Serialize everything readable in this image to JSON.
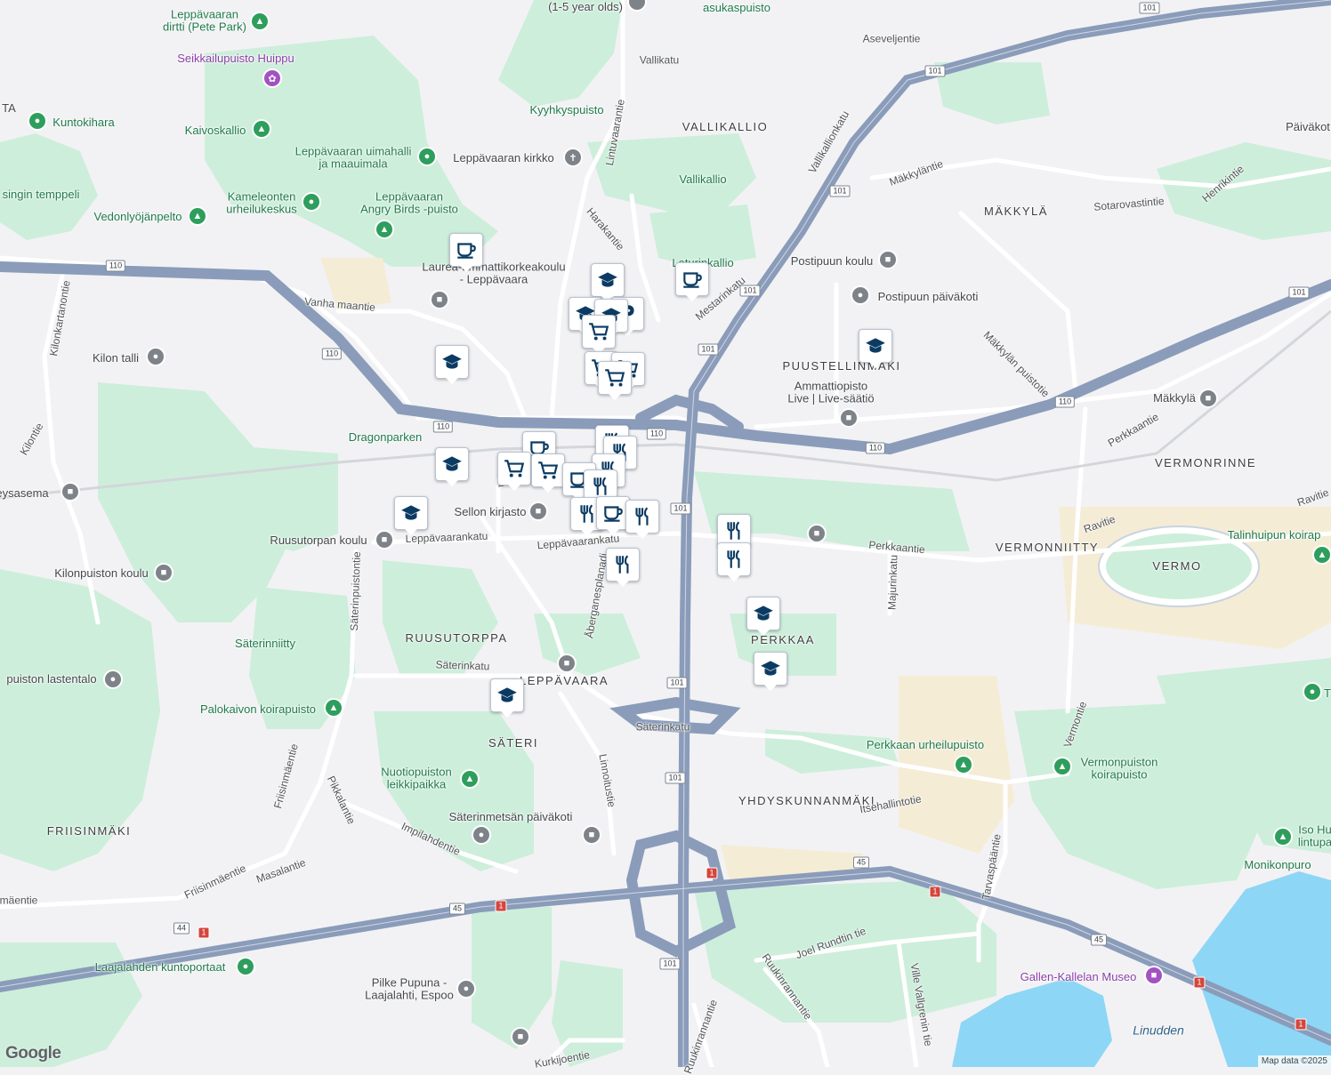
{
  "map": {
    "districts": [
      {
        "name": "VALLIKALLIO"
      },
      {
        "name": "MÄKKYLÄ"
      },
      {
        "name": "PUUSTELLINMÄKI"
      },
      {
        "name": "VERMONRINNE"
      },
      {
        "name": "VERMONNIITTY"
      },
      {
        "name": "VERMO"
      },
      {
        "name": "RUUSUTORPPA"
      },
      {
        "name": "LEPPÄVAARA"
      },
      {
        "name": "SÄTERI"
      },
      {
        "name": "PERKKAA"
      },
      {
        "name": "YHDYSKUNNANMÄKI"
      },
      {
        "name": "FRIISINMÄKI"
      }
    ],
    "places": [
      {
        "name": "(1-5 year olds)",
        "kind": "gray"
      },
      {
        "name": "asukaspuisto",
        "kind": "green"
      },
      {
        "name": "Leppävaaran\ndirtti (Pete Park)",
        "kind": "green"
      },
      {
        "name": "Seikkailupuisto Huippu",
        "kind": "purple"
      },
      {
        "name": "Kuntokihara",
        "kind": "green"
      },
      {
        "name": "Kaivoskallio",
        "kind": "green"
      },
      {
        "name": "Leppävaaran uimahalli\nja maauimala",
        "kind": "green"
      },
      {
        "name": "Kameleonten\nurheilukeskus",
        "kind": "green"
      },
      {
        "name": "Leppävaaran\nAngry Birds -puisto",
        "kind": "green"
      },
      {
        "name": "Vedonlyöjänpelto",
        "kind": "green"
      },
      {
        "name": "singin temppeli",
        "kind": "green"
      },
      {
        "name": "Kyyhkyspuisto",
        "kind": "green"
      },
      {
        "name": "Leppävaaran kirkko",
        "kind": "gray"
      },
      {
        "name": "Vallikallio",
        "kind": "green"
      },
      {
        "name": "Laturinkallio",
        "kind": "green"
      },
      {
        "name": "Laurea-ammattikorkeakoulu\n- Leppävaara",
        "kind": "gray"
      },
      {
        "name": "Postipuun koulu",
        "kind": "gray"
      },
      {
        "name": "Postipuun päiväkoti",
        "kind": "gray"
      },
      {
        "name": "Ammattiopisto\nLive | Live-säätiö",
        "kind": "gray"
      },
      {
        "name": "Mäkkylä",
        "kind": "gray"
      },
      {
        "name": "Kilon talli",
        "kind": "gray"
      },
      {
        "name": "Dragonparken",
        "kind": "green"
      },
      {
        "name": "eysasema",
        "kind": "gray"
      },
      {
        "name": "Sellon kirjasto",
        "kind": "gray"
      },
      {
        "name": "Ruusutorpan koulu",
        "kind": "gray"
      },
      {
        "name": "Kilonpuiston koulu",
        "kind": "gray"
      },
      {
        "name": "Säterinniitty",
        "kind": "green"
      },
      {
        "name": "puiston lastentalo",
        "kind": "gray"
      },
      {
        "name": "Palokaivon koirapuisto",
        "kind": "green"
      },
      {
        "name": "Nuotiopuiston\nleikkipaikka",
        "kind": "green"
      },
      {
        "name": "Säterinmetsän päiväkoti",
        "kind": "gray"
      },
      {
        "name": "Perkkaan urheilupuisto",
        "kind": "green"
      },
      {
        "name": "Vermonpuiston\nkoirapuisto",
        "kind": "green"
      },
      {
        "name": "Talinhuipun koirap",
        "kind": "green"
      },
      {
        "name": "Monikonpuro",
        "kind": "green"
      },
      {
        "name": "Iso Hu\nlintupa",
        "kind": "green"
      },
      {
        "name": "Laajalahden kuntoportaat",
        "kind": "green"
      },
      {
        "name": "Pilke Pupuna -\nLaajalahti, Espoo",
        "kind": "gray"
      },
      {
        "name": "Gallen-Kallelan Museo",
        "kind": "purple"
      },
      {
        "name": "Linudden",
        "kind": "water"
      },
      {
        "name": "Päiväkot",
        "kind": "gray"
      },
      {
        "name": "TA",
        "kind": "gray"
      },
      {
        "name": "T",
        "kind": "green"
      }
    ],
    "roads": [
      {
        "name": "Vallikatu"
      },
      {
        "name": "Aseveljentie"
      },
      {
        "name": "Lintuvaarantie"
      },
      {
        "name": "Harakantie"
      },
      {
        "name": "Mestarinkatu"
      },
      {
        "name": "Vallikallionkatu"
      },
      {
        "name": "Mäkkyläntie"
      },
      {
        "name": "Sotarovastintie"
      },
      {
        "name": "Henrikintie"
      },
      {
        "name": "Mäkkylän puistotie"
      },
      {
        "name": "Perkkaantie"
      },
      {
        "name": "Vanha maantie"
      },
      {
        "name": "Kilonkartanontie"
      },
      {
        "name": "Kilontie"
      },
      {
        "name": "Leppävaarankatu"
      },
      {
        "name": "Leppävaarankatu"
      },
      {
        "name": "Perkkaantie"
      },
      {
        "name": "Majurinkatu"
      },
      {
        "name": "Ravitie"
      },
      {
        "name": "Ravitie"
      },
      {
        "name": "Säterinpuistontie"
      },
      {
        "name": "Åberganesplanadi"
      },
      {
        "name": "Säterinkatu"
      },
      {
        "name": "Säterinkatu"
      },
      {
        "name": "Linnoitustie"
      },
      {
        "name": "Friisinmäentie"
      },
      {
        "name": "Pikkalantie"
      },
      {
        "name": "Impilahdentie"
      },
      {
        "name": "Masalantie"
      },
      {
        "name": "Friisinmäentie"
      },
      {
        "name": "mäentie"
      },
      {
        "name": "Itsehallintotie"
      },
      {
        "name": "Vermontie"
      },
      {
        "name": "Tarvaspääntie"
      },
      {
        "name": "Joel Rundtin tie"
      },
      {
        "name": "Ruukinrannantie"
      },
      {
        "name": "Ruukinrannantie"
      },
      {
        "name": "Ville Vallgrenin tie"
      },
      {
        "name": "Kurkijoentie"
      },
      {
        "name": "Ra"
      }
    ],
    "shields": [
      {
        "num": "101",
        "kind": "white"
      },
      {
        "num": "101",
        "kind": "white"
      },
      {
        "num": "101",
        "kind": "white"
      },
      {
        "num": "101",
        "kind": "white"
      },
      {
        "num": "101",
        "kind": "white"
      },
      {
        "num": "101",
        "kind": "white"
      },
      {
        "num": "101",
        "kind": "white"
      },
      {
        "num": "101",
        "kind": "white"
      },
      {
        "num": "101",
        "kind": "white"
      },
      {
        "num": "101",
        "kind": "white"
      },
      {
        "num": "110",
        "kind": "white"
      },
      {
        "num": "110",
        "kind": "white"
      },
      {
        "num": "110",
        "kind": "white"
      },
      {
        "num": "110",
        "kind": "white"
      },
      {
        "num": "110",
        "kind": "white"
      },
      {
        "num": "110",
        "kind": "white"
      },
      {
        "num": "110",
        "kind": "white"
      },
      {
        "num": "45",
        "kind": "white"
      },
      {
        "num": "45",
        "kind": "white"
      },
      {
        "num": "45",
        "kind": "white"
      },
      {
        "num": "44",
        "kind": "white"
      },
      {
        "num": "1",
        "kind": "red"
      },
      {
        "num": "1",
        "kind": "red"
      },
      {
        "num": "1",
        "kind": "red"
      },
      {
        "num": "1",
        "kind": "red"
      },
      {
        "num": "1",
        "kind": "red"
      },
      {
        "num": "1",
        "kind": "red"
      }
    ],
    "markers": [
      {
        "icon": "school"
      },
      {
        "icon": "school"
      },
      {
        "icon": "school"
      },
      {
        "icon": "school"
      },
      {
        "icon": "school"
      },
      {
        "icon": "school"
      },
      {
        "icon": "school"
      },
      {
        "icon": "school"
      },
      {
        "icon": "school"
      },
      {
        "icon": "school"
      },
      {
        "icon": "cafe"
      },
      {
        "icon": "cafe"
      },
      {
        "icon": "cafe"
      },
      {
        "icon": "cafe"
      },
      {
        "icon": "parking"
      },
      {
        "icon": "shop"
      },
      {
        "icon": "shop"
      },
      {
        "icon": "shop"
      },
      {
        "icon": "shop"
      },
      {
        "icon": "shop"
      },
      {
        "icon": "shop"
      },
      {
        "icon": "restaurant"
      },
      {
        "icon": "restaurant"
      },
      {
        "icon": "restaurant"
      },
      {
        "icon": "restaurant"
      },
      {
        "icon": "restaurant"
      },
      {
        "icon": "restaurant"
      },
      {
        "icon": "restaurant"
      },
      {
        "icon": "restaurant"
      },
      {
        "icon": "restaurant"
      },
      {
        "icon": "restaurant"
      }
    ],
    "attribution": "Map data ©2025",
    "logo": "Google",
    "colors": {
      "park": "#cdeedb",
      "water": "#8ed6f5",
      "highway": "#8a9cba",
      "road": "#ffffff",
      "land": "#f2f2f4",
      "marker": "#0b3b63"
    }
  }
}
